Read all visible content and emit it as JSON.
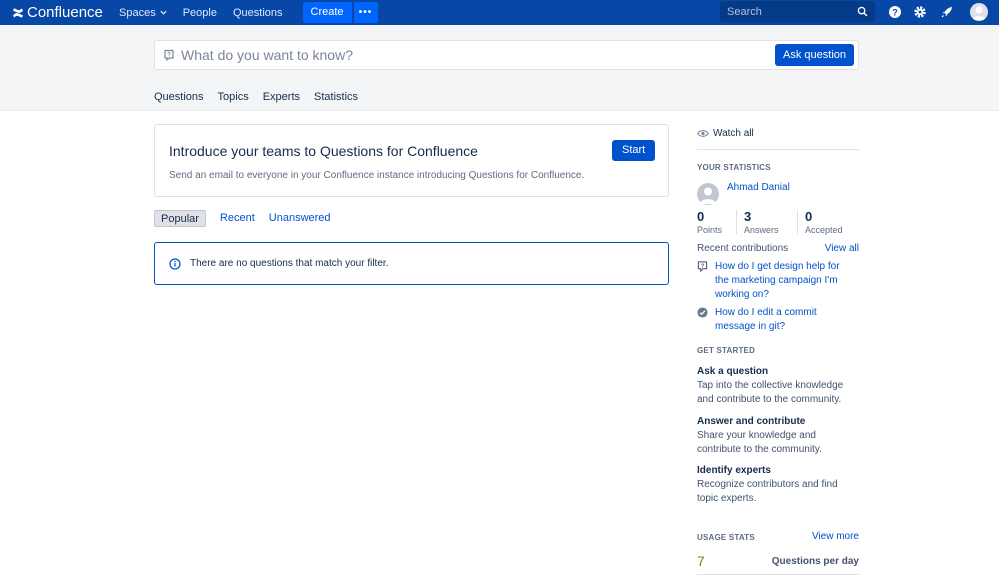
{
  "topnav": {
    "logo": "Confluence",
    "spaces": "Spaces",
    "people": "People",
    "questions": "Questions",
    "create": "Create",
    "more": "•••",
    "search_placeholder": "Search"
  },
  "ask": {
    "placeholder": "What do you want to know?",
    "button": "Ask question"
  },
  "tabs": [
    "Questions",
    "Topics",
    "Experts",
    "Statistics"
  ],
  "intro": {
    "title": "Introduce your teams to Questions for Confluence",
    "description": "Send an email to everyone in your Confluence instance introducing Questions for Confluence.",
    "button": "Start"
  },
  "filters": [
    "Popular",
    "Recent",
    "Unanswered"
  ],
  "empty_message": "There are no questions that match your filter.",
  "sidebar": {
    "watch_all": "Watch all",
    "your_statistics": "YOUR STATISTICS",
    "user_name": "Ahmad Danial",
    "stats": [
      {
        "value": "0",
        "label": "Points"
      },
      {
        "value": "3",
        "label": "Answers"
      },
      {
        "value": "0",
        "label": "Accepted"
      }
    ],
    "recent_contributions": "Recent contributions",
    "view_all": "View all",
    "contributions": [
      {
        "text": "How do I get design help for the marketing campaign I'm working on?",
        "icon": "question-icon"
      },
      {
        "text": "How do I edit a commit message in git?",
        "icon": "check-circle-icon"
      }
    ],
    "get_started": "GET STARTED",
    "started_items": [
      {
        "title": "Ask a question",
        "desc": "Tap into the collective knowledge and contribute to the community."
      },
      {
        "title": "Answer and contribute",
        "desc": "Share your knowledge and contribute to the community."
      },
      {
        "title": "Identify experts",
        "desc": "Recognize contributors and find topic experts."
      }
    ],
    "usage_stats": "USAGE STATS",
    "view_more": "View more",
    "usage_value": "7",
    "usage_label": "Questions per day"
  },
  "colors": {
    "nav_bg": "#0747a6",
    "primary": "#0052cc",
    "usage_value": "#6b8e23"
  }
}
